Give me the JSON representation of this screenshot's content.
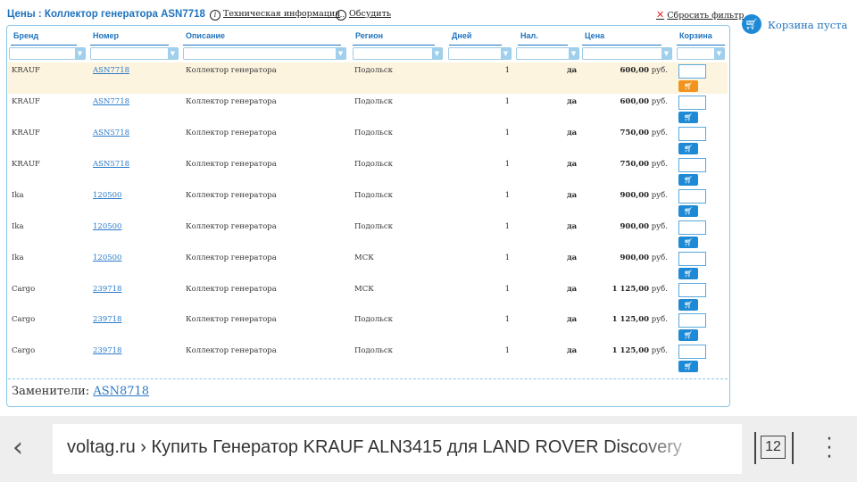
{
  "header": {
    "title": "Цены : Коллектор генератора ASN7718",
    "tech_info": "Техническая информация",
    "discuss": "Обсудить",
    "reset_filter": "Сбросить фильтр",
    "cart_status": "Корзина пуста"
  },
  "table": {
    "columns": [
      "Бренд",
      "Номер",
      "Описание",
      "Регион",
      "Дней",
      "Нал.",
      "Цена",
      "Корзина"
    ],
    "currency": "руб.",
    "rows": [
      {
        "brand": "KRAUF",
        "number": "ASN7718",
        "description": "Коллектор генератора",
        "region": "Подольск",
        "days": "1",
        "stock": "да",
        "price": "600,00"
      },
      {
        "brand": "KRAUF",
        "number": "ASN7718",
        "description": "Коллектор генератора",
        "region": "Подольск",
        "days": "1",
        "stock": "да",
        "price": "600,00"
      },
      {
        "brand": "KRAUF",
        "number": "ASN5718",
        "description": "Коллектор генератора",
        "region": "Подольск",
        "days": "1",
        "stock": "да",
        "price": "750,00"
      },
      {
        "brand": "KRAUF",
        "number": "ASN5718",
        "description": "Коллектор генератора",
        "region": "Подольск",
        "days": "1",
        "stock": "да",
        "price": "750,00"
      },
      {
        "brand": "Ika",
        "number": "120500",
        "description": "Коллектор генератора",
        "region": "Подольск",
        "days": "1",
        "stock": "да",
        "price": "900,00"
      },
      {
        "brand": "Ika",
        "number": "120500",
        "description": "Коллектор генератора",
        "region": "Подольск",
        "days": "1",
        "stock": "да",
        "price": "900,00"
      },
      {
        "brand": "Ika",
        "number": "120500",
        "description": "Коллектор генератора",
        "region": "МСК",
        "days": "1",
        "stock": "да",
        "price": "900,00"
      },
      {
        "brand": "Cargo",
        "number": "239718",
        "description": "Коллектор генератора",
        "region": "МСК",
        "days": "1",
        "stock": "да",
        "price": "1 125,00"
      },
      {
        "brand": "Cargo",
        "number": "239718",
        "description": "Коллектор генератора",
        "region": "Подольск",
        "days": "1",
        "stock": "да",
        "price": "1 125,00"
      },
      {
        "brand": "Cargo",
        "number": "239718",
        "description": "Коллектор генератора",
        "region": "Подольск",
        "days": "1",
        "stock": "да",
        "price": "1 125,00"
      }
    ]
  },
  "substitutes": {
    "label": "Заменители:",
    "link": "ASN8718"
  },
  "browser": {
    "url": "voltag.ru › Купить Генератор KRAUF ALN3415 для LAND ROVER Discovery",
    "tab_count": "12"
  },
  "icons": {
    "info": "info-icon",
    "discuss": "chat-bubble-icon",
    "reset": "close-icon",
    "cart": "cart-icon",
    "back": "back-arrow-icon",
    "reload": "reload-icon",
    "menu": "more-vert-icon"
  },
  "colors": {
    "accent": "#1e73be",
    "cart_button": "#1e8ad6",
    "cart_button_active": "#f0941e",
    "highlight_row": "#fdf4e0",
    "reset_x": "#e0262a"
  }
}
